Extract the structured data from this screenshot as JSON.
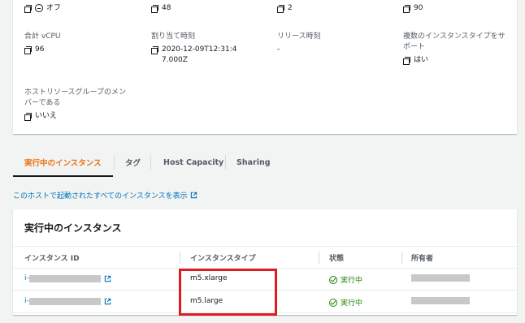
{
  "details": {
    "top_values": [
      "オフ",
      "48",
      "2",
      "90"
    ],
    "fields": [
      {
        "label": "合計 vCPU",
        "value": "96"
      },
      {
        "label": "割り当て時刻",
        "value": "2020-12-09T12:31:47.000Z"
      },
      {
        "label": "リリース時刻",
        "value": "-"
      },
      {
        "label": "複数のインスタンスタイプをサポート",
        "value": "はい"
      },
      {
        "label": "ホストリソースグループのメンバーである",
        "value": "いいえ"
      }
    ]
  },
  "tabs": [
    "実行中のインスタンス",
    "タグ",
    "Host Capacity",
    "Sharing"
  ],
  "link_text": "このホストで起動されたすべてのインスタンスを表示",
  "table": {
    "title": "実行中のインスタンス",
    "headers": [
      "インスタンス ID",
      "インスタンスタイプ",
      "状態",
      "所有者"
    ],
    "rows": [
      {
        "id_prefix": "i-",
        "type": "m5.xlarge",
        "state": "実行中"
      },
      {
        "id_prefix": "i-",
        "type": "m5.large",
        "state": "実行中"
      }
    ]
  },
  "colors": {
    "accent": "#ec7211",
    "link": "#0073bb",
    "success": "#1d8102",
    "highlight": "#e01b24"
  }
}
